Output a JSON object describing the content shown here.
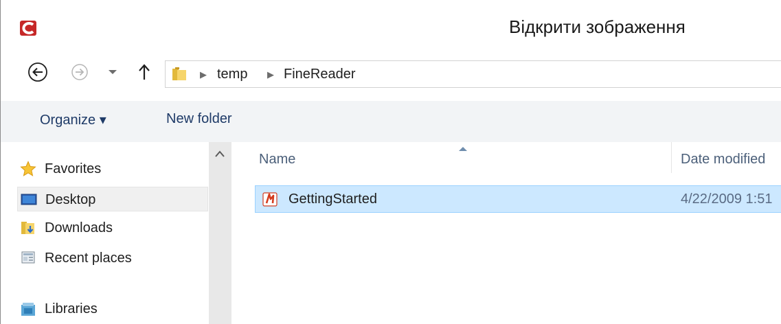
{
  "window": {
    "title": "Відкрити зображення",
    "accent_color": "#cce8ff"
  },
  "address": {
    "crumbs": [
      "temp",
      "FineReader"
    ]
  },
  "toolbar": {
    "organize_label": "Organize ▾",
    "new_folder_label": "New folder"
  },
  "nav": {
    "favorites_label": "Favorites",
    "desktop_label": "Desktop",
    "downloads_label": "Downloads",
    "recent_label": "Recent places",
    "libraries_label": "Libraries"
  },
  "file_list": {
    "columns": [
      "Name",
      "Date modified"
    ],
    "rows": [
      {
        "name": "GettingStarted",
        "date_modified": "4/22/2009 1:51"
      }
    ]
  }
}
